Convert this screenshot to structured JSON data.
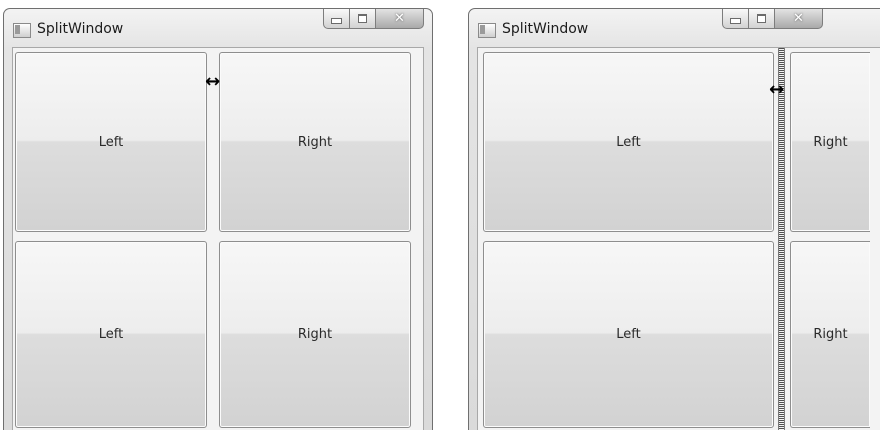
{
  "window_left": {
    "title": "SplitWindow",
    "buttons": {
      "top_left": "Left",
      "top_right": "Right",
      "bottom_left": "Left",
      "bottom_right": "Right"
    },
    "cursor_glyph": "↔"
  },
  "window_right": {
    "title": "SplitWindow",
    "buttons": {
      "top_left": "Left",
      "top_right": "Right",
      "bottom_left": "Left",
      "bottom_right": "Right"
    },
    "cursor_glyph": "↔"
  },
  "caption": {
    "close_glyph": "✕"
  },
  "icons": [
    "app-icon",
    "minimize-icon",
    "maximize-icon",
    "close-icon",
    "resize-cursor-icon"
  ]
}
